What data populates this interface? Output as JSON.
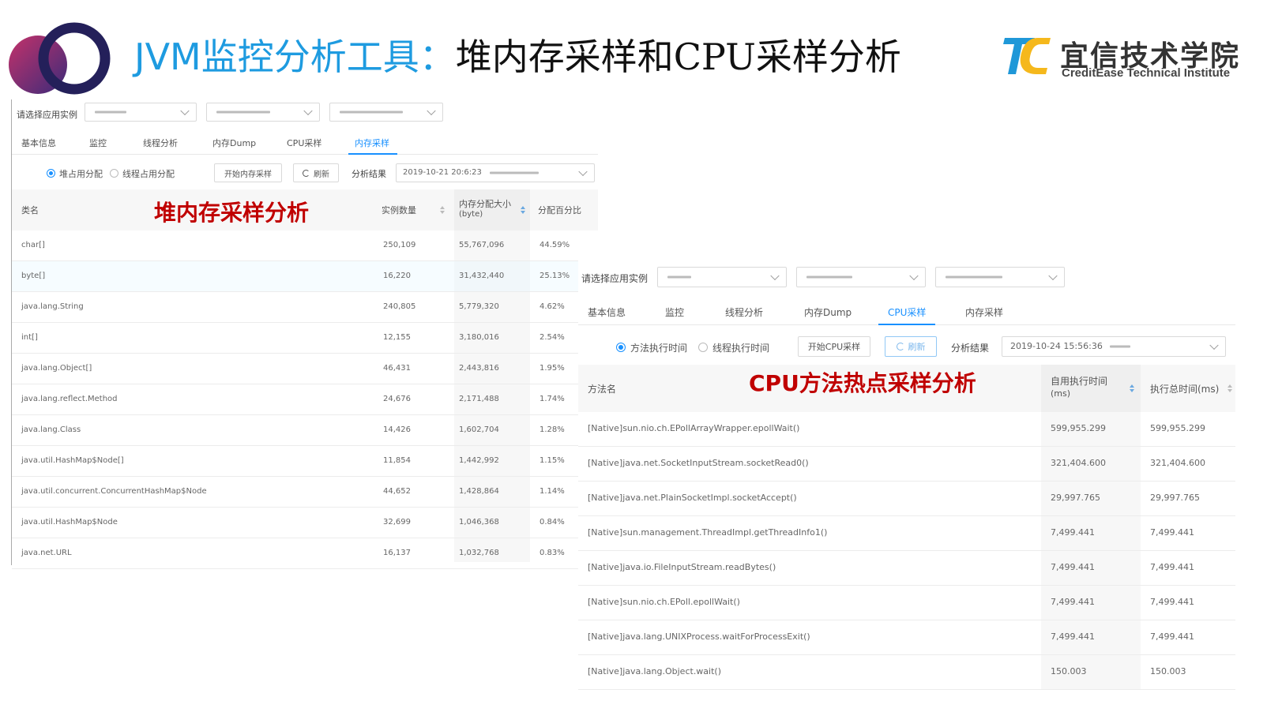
{
  "slide": {
    "title_part1": "JVM监控分析工具：",
    "title_part2": "堆内存采样和CPU采样分析",
    "brand_name": "宜信技术学院",
    "brand_sub": "CreditEase Technical Institute",
    "brand_colors": {
      "blue": "#1f98d8",
      "yellow": "#f5b81c",
      "ring_outer": "#2a1f5c",
      "ring_fill": "#8a2a6a"
    }
  },
  "heap_panel": {
    "instance_label": "请选择应用实例",
    "tabs": [
      "基本信息",
      "监控",
      "线程分析",
      "内存Dump",
      "CPU采样",
      "内存采样"
    ],
    "active_tab": "内存采样",
    "radio_heap": "堆占用分配",
    "radio_thread": "线程占用分配",
    "start_button": "开始内存采样",
    "refresh_button": "刷新",
    "result_label": "分析结果",
    "result_value": "2019-10-21 20:6:23",
    "overlay_title": "堆内存采样分析",
    "columns": [
      "类名",
      "实例数量",
      "内存分配大小",
      "(byte)",
      "分配百分比"
    ],
    "rows": [
      {
        "name": "char[]",
        "count": "250,109",
        "bytes": "55,767,096",
        "pct": "44.59%"
      },
      {
        "name": "byte[]",
        "count": "16,220",
        "bytes": "31,432,440",
        "pct": "25.13%"
      },
      {
        "name": "java.lang.String",
        "count": "240,805",
        "bytes": "5,779,320",
        "pct": "4.62%"
      },
      {
        "name": "int[]",
        "count": "12,155",
        "bytes": "3,180,016",
        "pct": "2.54%"
      },
      {
        "name": "java.lang.Object[]",
        "count": "46,431",
        "bytes": "2,443,816",
        "pct": "1.95%"
      },
      {
        "name": "java.lang.reflect.Method",
        "count": "24,676",
        "bytes": "2,171,488",
        "pct": "1.74%"
      },
      {
        "name": "java.lang.Class",
        "count": "14,426",
        "bytes": "1,602,704",
        "pct": "1.28%"
      },
      {
        "name": "java.util.HashMap$Node[]",
        "count": "11,854",
        "bytes": "1,442,992",
        "pct": "1.15%"
      },
      {
        "name": "java.util.concurrent.ConcurrentHashMap$Node",
        "count": "44,652",
        "bytes": "1,428,864",
        "pct": "1.14%"
      },
      {
        "name": "java.util.HashMap$Node",
        "count": "32,699",
        "bytes": "1,046,368",
        "pct": "0.84%"
      },
      {
        "name": "java.net.URL",
        "count": "16,137",
        "bytes": "1,032,768",
        "pct": "0.83%"
      }
    ]
  },
  "cpu_panel": {
    "instance_label": "请选择应用实例",
    "tabs": [
      "基本信息",
      "监控",
      "线程分析",
      "内存Dump",
      "CPU采样",
      "内存采样"
    ],
    "active_tab": "CPU采样",
    "radio_method": "方法执行时间",
    "radio_thread": "线程执行时间",
    "start_button": "开始CPU采样",
    "refresh_button": "刷新",
    "result_label": "分析结果",
    "result_value": "2019-10-24 15:56:36",
    "overlay_title": "CPU方法热点采样分析",
    "columns": [
      "方法名",
      "自用执行时间",
      "(ms)",
      "执行总时间(ms)"
    ],
    "rows": [
      {
        "method": "[Native]sun.nio.ch.EPollArrayWrapper.epollWait()",
        "self": "599,955.299",
        "total": "599,955.299"
      },
      {
        "method": "[Native]java.net.SocketInputStream.socketRead0()",
        "self": "321,404.600",
        "total": "321,404.600"
      },
      {
        "method": "[Native]java.net.PlainSocketImpl.socketAccept()",
        "self": "29,997.765",
        "total": "29,997.765"
      },
      {
        "method": "[Native]sun.management.ThreadImpl.getThreadInfo1()",
        "self": "7,499.441",
        "total": "7,499.441"
      },
      {
        "method": "[Native]java.io.FileInputStream.readBytes()",
        "self": "7,499.441",
        "total": "7,499.441"
      },
      {
        "method": "[Native]sun.nio.ch.EPoll.epollWait()",
        "self": "7,499.441",
        "total": "7,499.441"
      },
      {
        "method": "[Native]java.lang.UNIXProcess.waitForProcessExit()",
        "self": "7,499.441",
        "total": "7,499.441"
      },
      {
        "method": "[Native]java.lang.Object.wait()",
        "self": "150.003",
        "total": "150.003"
      }
    ]
  }
}
